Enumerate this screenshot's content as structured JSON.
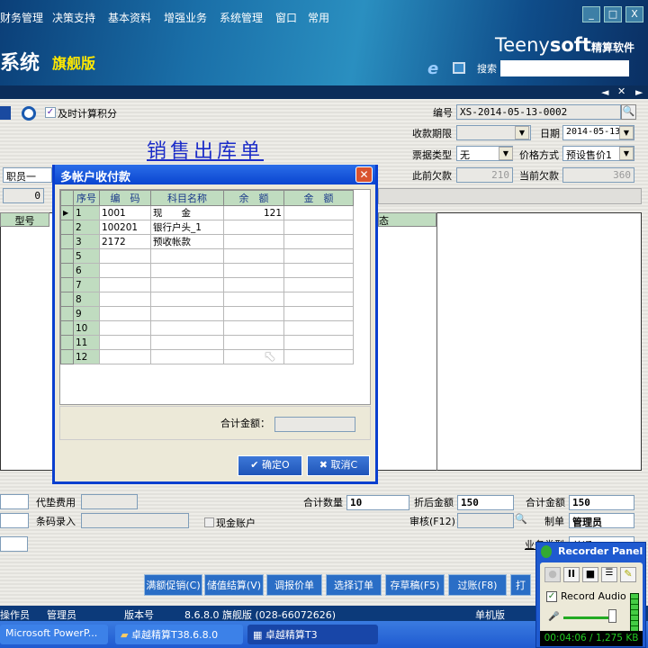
{
  "menu": [
    "财务管理",
    "决策支持",
    "基本资料",
    "增强业务",
    "系统管理",
    "窗口",
    "常用"
  ],
  "window_controls": {
    "minimize": "_",
    "maximize": "□",
    "close": "X"
  },
  "banner": {
    "system": "系统",
    "edition": "旗舰版",
    "brand_a": "Teeny",
    "brand_b": "soft",
    "brand_cn": "精算软件",
    "search_label": "搜索",
    "search_value": ""
  },
  "tabbar": {
    "prev": "◄",
    "close": "✕",
    "next": "►"
  },
  "toolbar": {
    "checkbox_label": "及时计算积分",
    "checked": true
  },
  "form": {
    "title": "销售出库单",
    "bianhao_label": "编号",
    "bianhao": "XS-2014-05-13-0002",
    "shoukuan_label": "收款期限",
    "shoukuan": "",
    "riqi_label": "日期",
    "riqi": "2014-05-13",
    "piaoju_label": "票据类型",
    "piaoju": "无",
    "jiage_label": "价格方式",
    "jiage": "预设售价1",
    "ciqian_label": "此前欠款",
    "ciqian": "210",
    "dangqian_label": "当前欠款",
    "dangqian": "360",
    "staff": "职员一",
    "zero": "0",
    "grid_headers": [
      "型号",
      "态"
    ]
  },
  "dialog": {
    "title": "多帐户收付款",
    "close": "✕",
    "headers": [
      "序号",
      "编　码",
      "科目名称",
      "余　额",
      "金　额"
    ],
    "rows": [
      [
        "1",
        "1001",
        "现　　金",
        "121",
        ""
      ],
      [
        "2",
        "100201",
        "银行户头_1",
        "",
        ""
      ],
      [
        "3",
        "2172",
        "预收帐款",
        "",
        ""
      ],
      [
        "5",
        "",
        "",
        "",
        ""
      ],
      [
        "6",
        "",
        "",
        "",
        ""
      ],
      [
        "7",
        "",
        "",
        "",
        ""
      ],
      [
        "8",
        "",
        "",
        "",
        ""
      ],
      [
        "9",
        "",
        "",
        "",
        ""
      ],
      [
        "10",
        "",
        "",
        "",
        ""
      ],
      [
        "11",
        "",
        "",
        "",
        ""
      ],
      [
        "12",
        "",
        "",
        "",
        ""
      ]
    ],
    "total_label": "合计金额：",
    "total": "",
    "ok": "确定O",
    "cancel": "取消C"
  },
  "bottom": {
    "daidian_label": "代垫费用",
    "tiaoma_label": "条码录入",
    "cash_label": "现金账户",
    "qty_label": "合计数量",
    "qty": "10",
    "zhehou_label": "折后金额",
    "zhehou": "150",
    "total_label": "合计金额",
    "total": "150",
    "shenhe_label": "审核(F12)",
    "zhidan_label": "制单",
    "zhidan": "管理员",
    "yewu_label": "业务类型",
    "yewu": "普通"
  },
  "buttons": [
    "满额促销(C)",
    "储值结算(V)",
    "调报价单",
    "选择订单",
    "存草稿(F5)",
    "过账(F8)",
    "打"
  ],
  "status": {
    "op_label": "操作员",
    "op": "管理员",
    "ver_label": "版本号",
    "ver": "8.6.8.0 旗舰版 (028-66072626)",
    "mode": "单机版"
  },
  "taskbar": [
    "Microsoft PowerP...",
    "卓越精算T38.6.8.0",
    "卓越精算T3"
  ],
  "recorder": {
    "title": "Recorder Panel",
    "record_audio": "Record Audio",
    "time": "00:04:06 / 1,275 KB",
    "audio_checked": true
  }
}
